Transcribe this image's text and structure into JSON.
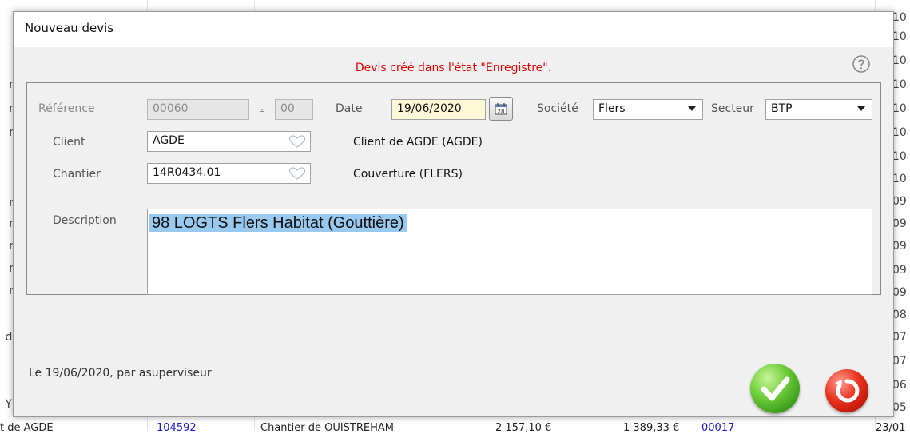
{
  "window": {
    "title": "Nouveau devis",
    "status_message": "Devis créé dans l'état \"Enregistre\"."
  },
  "form": {
    "reference_label": "Référence",
    "reference_value": "00060",
    "reference_separator": ".",
    "reference_suffix": "00",
    "date_label": "Date",
    "date_value": "19/06/2020",
    "societe_label": "Société",
    "societe_value": "Flers",
    "secteur_label": "Secteur",
    "secteur_value": "BTP",
    "client_label": "Client",
    "client_value": "AGDE",
    "client_info": "Client de AGDE (AGDE)",
    "chantier_label": "Chantier",
    "chantier_value": "14R0434.01",
    "chantier_info": "Couverture (FLERS)",
    "description_label": "Description",
    "description_value": "98 LOGTS Flers Habitat (Gouttière)"
  },
  "footer": {
    "audit_text": "Le 19/06/2020, par asuperviseur"
  },
  "background": {
    "left_fragments": [
      "t",
      "t",
      "t",
      "ni",
      "ni",
      "ni",
      "t",
      "t",
      "ni",
      "ni",
      "ni",
      "ni",
      "ni",
      "t",
      "de",
      "t",
      "YS"
    ],
    "right_fragments": [
      "10",
      "10",
      "10",
      "10",
      "10",
      "10",
      "10",
      "10",
      "09",
      "09",
      "09",
      "09",
      "09",
      "08",
      "07",
      "07",
      "06",
      "05"
    ],
    "bottom_fragments": [
      "t de AGDE",
      "104592",
      "Chantier de OUISTREHAM",
      "2 157,10 €",
      "1 389,33 €",
      "00017",
      "23/01"
    ]
  },
  "colors": {
    "status_red": "#e00000",
    "ok_green": "#4caf1f",
    "cancel_red": "#d9261a",
    "selection_blue": "#99c9ef"
  },
  "icons": {
    "help": "question-circle-icon",
    "calendar": "calendar-icon",
    "lookup": "heart-icon",
    "ok": "checkmark-icon",
    "cancel": "undo-icon"
  }
}
